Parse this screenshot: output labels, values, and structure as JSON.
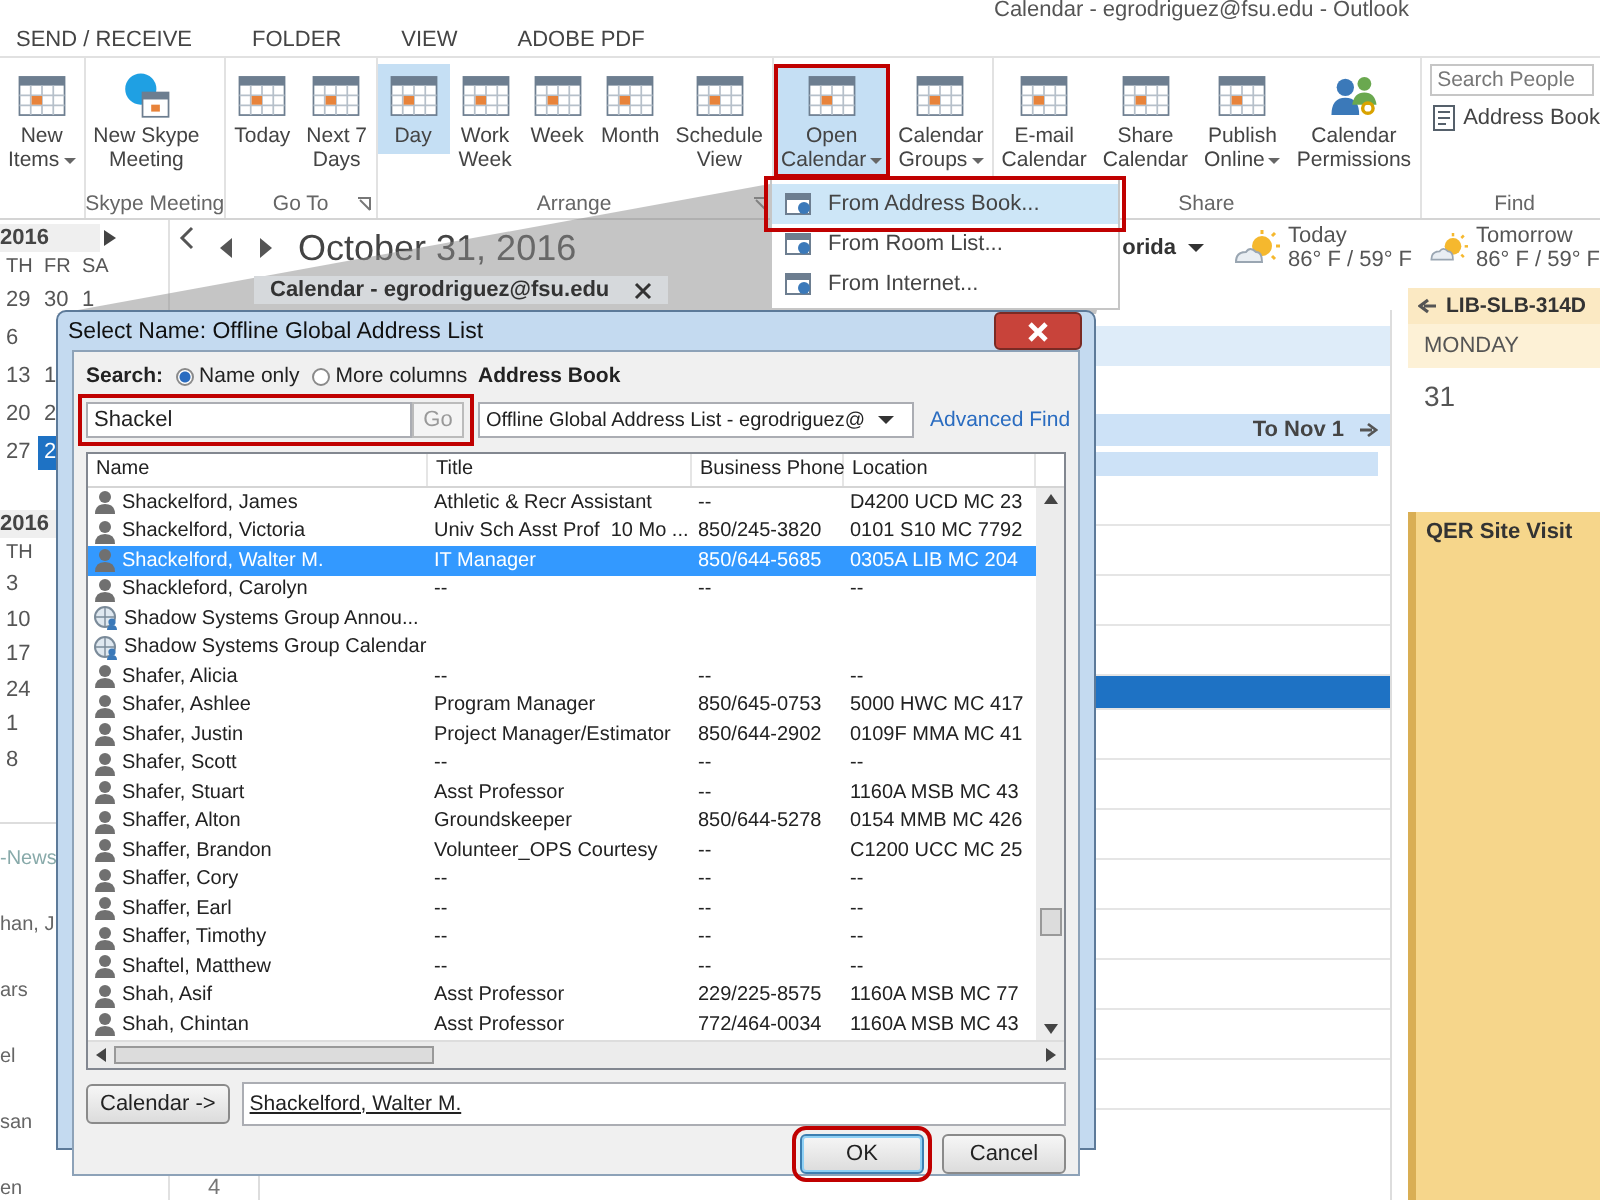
{
  "window": {
    "title": "Calendar - egrodriguez@fsu.edu - Outlook"
  },
  "ribbon_tabs": [
    "SEND / RECEIVE",
    "FOLDER",
    "VIEW",
    "ADOBE PDF"
  ],
  "ribbon": {
    "groups": [
      {
        "kind": "buttons",
        "buttons": [
          {
            "kind": "calendar",
            "lines": [
              "New",
              "Items"
            ],
            "dropdown": true,
            "selected": false
          }
        ]
      },
      {
        "kind": "buttons",
        "label": "Skype Meeting",
        "launcher": false,
        "buttons": [
          {
            "kind": "chat",
            "lines": [
              "New Skype",
              "Meeting"
            ],
            "dropdown": false,
            "selected": false
          }
        ]
      },
      {
        "kind": "buttons",
        "label": "Go To",
        "launcher": true,
        "buttons": [
          {
            "kind": "calendar",
            "lines": [
              "Today"
            ],
            "dropdown": false,
            "selected": false
          },
          {
            "kind": "calendar",
            "lines": [
              "Next 7",
              "Days"
            ],
            "dropdown": false,
            "selected": false
          }
        ]
      },
      {
        "kind": "buttons",
        "label": "Arrange",
        "launcher": true,
        "buttons": [
          {
            "kind": "calendar",
            "lines": [
              "Day"
            ],
            "dropdown": false,
            "selected": true
          },
          {
            "kind": "calendar",
            "lines": [
              "Work",
              "Week"
            ],
            "dropdown": false,
            "selected": false
          },
          {
            "kind": "calendar",
            "lines": [
              "Week"
            ],
            "dropdown": false,
            "selected": false
          },
          {
            "kind": "calendar",
            "lines": [
              "Month"
            ],
            "dropdown": false,
            "selected": false
          },
          {
            "kind": "calendar",
            "lines": [
              "Schedule",
              "View"
            ],
            "dropdown": false,
            "selected": false
          }
        ]
      },
      {
        "kind": "buttons",
        "buttons": [
          {
            "kind": "calendar",
            "lines": [
              "Open",
              "Calendar"
            ],
            "dropdown": true,
            "selected": true,
            "highlighted": true
          },
          {
            "kind": "calendar",
            "lines": [
              "Calendar",
              "Groups"
            ],
            "dropdown": true,
            "selected": false
          }
        ]
      },
      {
        "kind": "buttons",
        "label": "Share",
        "launcher": false,
        "buttons": [
          {
            "kind": "calendar",
            "lines": [
              "E-mail",
              "Calendar"
            ],
            "dropdown": false,
            "selected": false
          },
          {
            "kind": "calendar",
            "lines": [
              "Share",
              "Calendar"
            ],
            "dropdown": false,
            "selected": false
          },
          {
            "kind": "calendar",
            "lines": [
              "Publish",
              "Online"
            ],
            "dropdown": true,
            "selected": false
          },
          {
            "kind": "people",
            "lines": [
              "Calendar",
              "Permissions"
            ],
            "dropdown": false,
            "selected": false
          }
        ]
      },
      {
        "kind": "find",
        "label": "Find",
        "launcher": false,
        "search": {
          "placeholder": "Search People"
        },
        "buttons": [
          {
            "kind": "book",
            "lines": [
              "Address Book"
            ],
            "dropdown": false,
            "selected": false
          }
        ]
      }
    ]
  },
  "menu": {
    "items": [
      {
        "label": "From Address Book...",
        "selected": true,
        "highlighted": true
      },
      {
        "label": "From Room List...",
        "selected": false,
        "highlighted": false
      },
      {
        "label": "From Internet...",
        "selected": false,
        "highlighted": false
      }
    ]
  },
  "mini_calendars": [
    {
      "year": "2016",
      "weekdays": [
        "TH",
        "FR",
        "SA"
      ],
      "weeks": [
        [
          {
            "day": "29",
            "selected": false
          },
          {
            "day": "30",
            "selected": false
          },
          {
            "day": "1",
            "selected": false
          }
        ],
        [
          {
            "day": "6",
            "selected": false
          }
        ],
        [
          {
            "day": "13",
            "selected": false
          },
          {
            "day": "1",
            "selected": false
          }
        ],
        [
          {
            "day": "20",
            "selected": false
          },
          {
            "day": "2",
            "selected": false
          }
        ],
        [
          {
            "day": "27",
            "selected": false
          },
          {
            "day": "2",
            "selected": true
          }
        ]
      ]
    },
    {
      "year": "2016",
      "weekdays": [
        "TH"
      ],
      "weeks": [
        [
          {
            "day": "3",
            "selected": false
          }
        ],
        [
          {
            "day": "10",
            "selected": false
          }
        ],
        [
          {
            "day": "17",
            "selected": false
          }
        ],
        [
          {
            "day": "24",
            "selected": false
          }
        ],
        [
          {
            "day": "1",
            "selected": false
          }
        ],
        [
          {
            "day": "8",
            "selected": false
          }
        ]
      ]
    }
  ],
  "folders": [
    "-News",
    "han, J",
    "ars",
    "el",
    "san",
    "en"
  ],
  "navigation": {
    "date": "October 31, 2016",
    "location": "orida"
  },
  "weather": [
    {
      "day": "Today",
      "temps": "86° F / 59° F"
    },
    {
      "day": "Tomorrow",
      "temps": "86° F / 59° F"
    }
  ],
  "calendar_tab": {
    "label": "Calendar - egrodriguez@fsu.edu"
  },
  "day_view": {
    "banner": "To Nov 1",
    "time_label": "4"
  },
  "right_pane": {
    "room": "LIB-SLB-314D",
    "weekday": "MONDAY",
    "date": "31",
    "event": "QER Site Visit"
  },
  "dialog": {
    "title": "Select Name: Offline Global Address List",
    "search_label": "Search:",
    "search_modes": [
      {
        "label": "Name only",
        "selected": true
      },
      {
        "label": "More columns",
        "selected": false
      }
    ],
    "address_book_label": "Address Book",
    "search_field": {
      "value": "Shackel",
      "highlighted": true
    },
    "go_button": {
      "label": "Go",
      "disabled": true
    },
    "address_book": {
      "value": "Offline Global Address List - egrodriguez@"
    },
    "advanced_find": "Advanced Find",
    "table": {
      "columns": [
        "Name",
        "Title",
        "Business Phone",
        "Location"
      ],
      "rows": [
        {
          "kind": "person",
          "selected": false,
          "cells": [
            "Shackelford, James",
            "Athletic & Recr Assistant",
            "--",
            "D4200 UCD MC 23"
          ]
        },
        {
          "kind": "person",
          "selected": false,
          "cells": [
            "Shackelford, Victoria",
            "Univ Sch Asst Prof  10 Mo ...",
            "850/245-3820",
            "0101 S10 MC 7792"
          ]
        },
        {
          "kind": "person",
          "selected": true,
          "cells": [
            "Shackelford, Walter M.",
            "IT Manager",
            "850/644-5685",
            "0305A LIB MC 204"
          ]
        },
        {
          "kind": "person",
          "selected": false,
          "cells": [
            "Shackleford, Carolyn",
            "--",
            "--",
            "--"
          ]
        },
        {
          "kind": "group",
          "selected": false,
          "cells": [
            "Shadow Systems Group Annou..."
          ]
        },
        {
          "kind": "group",
          "selected": false,
          "cells": [
            "Shadow Systems Group Calendar"
          ]
        },
        {
          "kind": "person",
          "selected": false,
          "cells": [
            "Shafer, Alicia",
            "--",
            "--",
            "--"
          ]
        },
        {
          "kind": "person",
          "selected": false,
          "cells": [
            "Shafer, Ashlee",
            "Program Manager",
            "850/645-0753",
            "5000 HWC MC 417"
          ]
        },
        {
          "kind": "person",
          "selected": false,
          "cells": [
            "Shafer, Justin",
            "Project Manager/Estimator",
            "850/644-2902",
            "0109F MMA MC 41"
          ]
        },
        {
          "kind": "person",
          "selected": false,
          "cells": [
            "Shafer, Scott",
            "--",
            "--",
            "--"
          ]
        },
        {
          "kind": "person",
          "selected": false,
          "cells": [
            "Shafer, Stuart",
            "Asst Professor",
            "--",
            "1160A MSB MC 43"
          ]
        },
        {
          "kind": "person",
          "selected": false,
          "cells": [
            "Shaffer, Alton",
            "Groundskeeper",
            "850/644-5278",
            "0154 MMB MC 426"
          ]
        },
        {
          "kind": "person",
          "selected": false,
          "cells": [
            "Shaffer, Brandon",
            "Volunteer_OPS Courtesy",
            "--",
            "C1200 UCC MC 25"
          ]
        },
        {
          "kind": "person",
          "selected": false,
          "cells": [
            "Shaffer, Cory",
            "--",
            "--",
            "--"
          ]
        },
        {
          "kind": "person",
          "selected": false,
          "cells": [
            "Shaffer, Earl",
            "--",
            "--",
            "--"
          ]
        },
        {
          "kind": "person",
          "selected": false,
          "cells": [
            "Shaffer, Timothy",
            "--",
            "--",
            "--"
          ]
        },
        {
          "kind": "person",
          "selected": false,
          "cells": [
            "Shaftel, Matthew",
            "--",
            "--",
            "--"
          ]
        },
        {
          "kind": "person",
          "selected": false,
          "cells": [
            "Shah, Asif",
            "Asst Professor",
            "229/225-8575",
            "1160A MSB MC 77"
          ]
        },
        {
          "kind": "person",
          "selected": false,
          "cells": [
            "Shah, Chintan",
            "Asst Professor",
            "772/464-0034",
            "1160A MSB MC 43"
          ]
        }
      ]
    },
    "calendar_button": "Calendar ->",
    "calendar_field": {
      "value": "Shackelford, Walter M."
    },
    "buttons": [
      {
        "label": "OK",
        "default": true,
        "highlighted": true
      },
      {
        "label": "Cancel",
        "default": false,
        "highlighted": false
      }
    ]
  }
}
